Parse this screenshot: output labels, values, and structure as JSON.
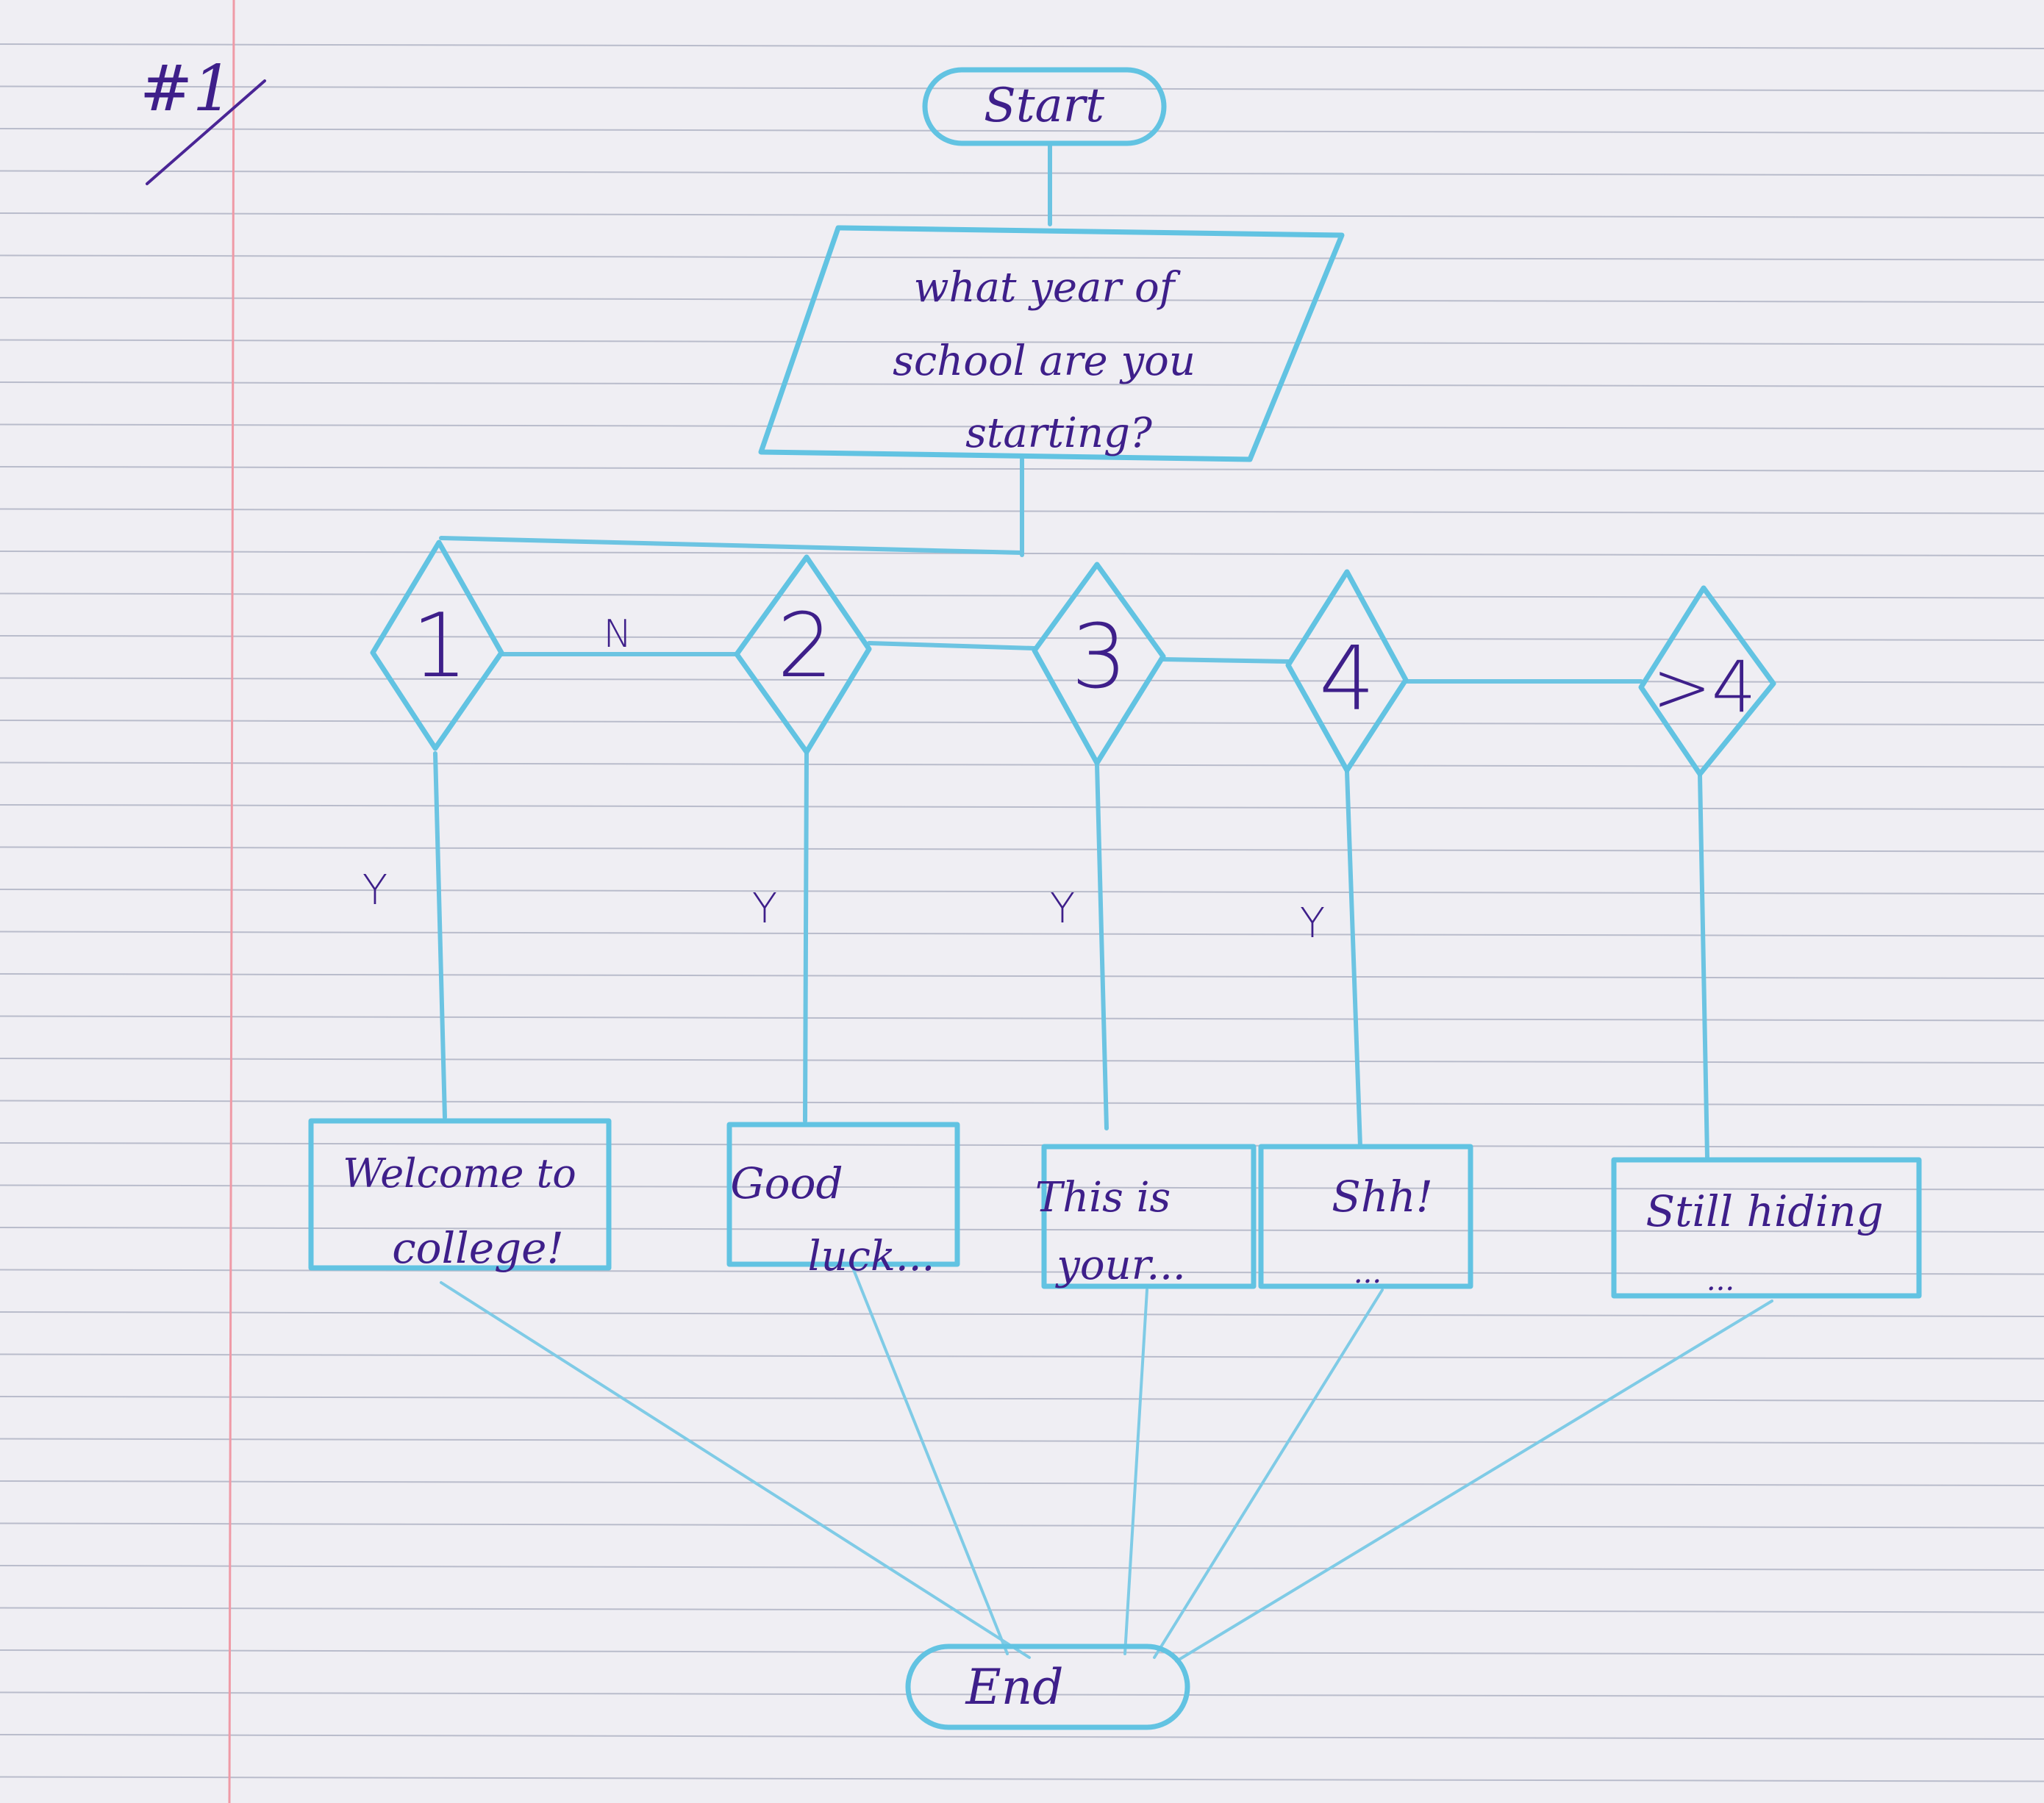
{
  "page": {
    "label": "#1",
    "colors": {
      "paper": "#efeef3",
      "rule": "#b9bccb",
      "margin": "#ef9aa6",
      "pencil": "#62c3e2",
      "ink": "#3e1f8a"
    }
  },
  "flowchart": {
    "start": {
      "label": "Start"
    },
    "input": {
      "lines": [
        "what year of",
        "school are you",
        "starting?"
      ]
    },
    "decisions": [
      {
        "label": "1"
      },
      {
        "label": "2"
      },
      {
        "label": "3"
      },
      {
        "label": "4"
      },
      {
        "label": ">4"
      }
    ],
    "no_label": "N",
    "yes_label": "Y",
    "outputs": [
      {
        "lines": [
          "Welcome to",
          "college!"
        ]
      },
      {
        "lines": [
          "Good",
          "luck..."
        ]
      },
      {
        "lines": [
          "This is",
          "your..."
        ]
      },
      {
        "lines": [
          "Shh!",
          "..."
        ]
      },
      {
        "lines": [
          "Still hiding",
          "..."
        ]
      }
    ],
    "end": {
      "label": "End"
    }
  }
}
